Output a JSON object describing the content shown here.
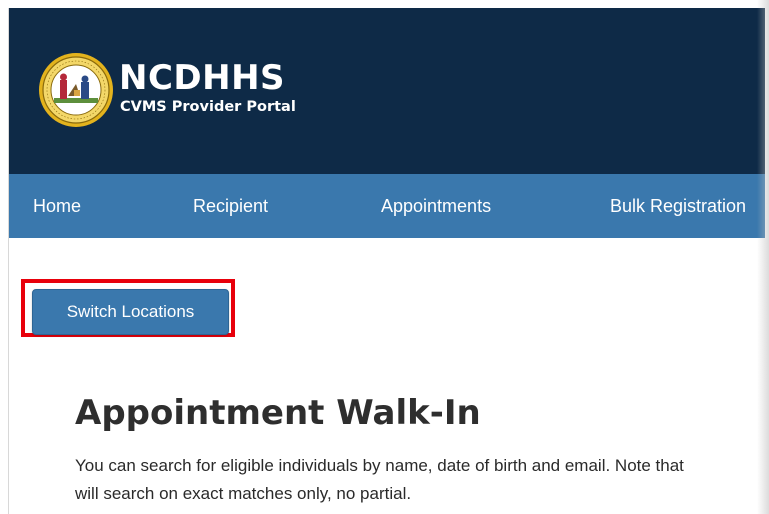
{
  "header": {
    "brand_title": "NCDHHS",
    "brand_subtitle": "CVMS Provider Portal",
    "seal_icon": "nc-state-seal-icon",
    "background_color": "#0e2a47"
  },
  "nav": {
    "background_color": "#3a78ad",
    "items": [
      {
        "label": "Home"
      },
      {
        "label": "Recipient"
      },
      {
        "label": "Appointments"
      },
      {
        "label": "Bulk Registration"
      }
    ]
  },
  "main": {
    "switch_locations_label": "Switch Locations",
    "highlight_color": "#e8000b",
    "heading": "Appointment Walk-In",
    "description_line1": "You can search for eligible individuals by name, date of birth and email. Note that",
    "description_line2": "will search on exact matches only, no partial."
  }
}
